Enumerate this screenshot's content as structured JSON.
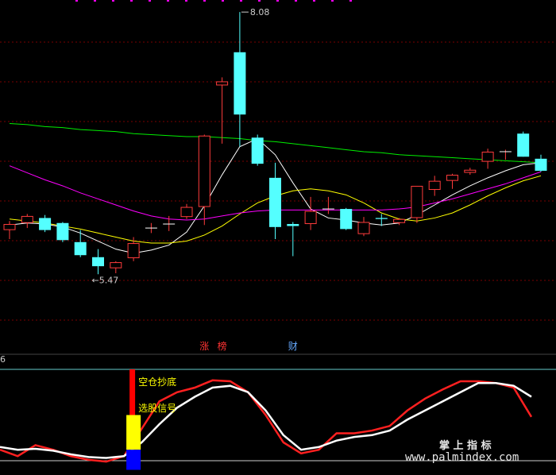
{
  "chart_data": [
    {
      "type": "candlestick",
      "price_range": [
        4.8,
        8.2
      ],
      "grid": "dashed-horizontal",
      "candles": [
        {
          "o": 5.91,
          "h": 6.0,
          "l": 5.82,
          "c": 5.97
        },
        {
          "o": 5.98,
          "h": 6.07,
          "l": 5.93,
          "c": 6.05
        },
        {
          "o": 6.03,
          "h": 6.06,
          "l": 5.89,
          "c": 5.91
        },
        {
          "o": 5.98,
          "h": 5.99,
          "l": 5.79,
          "c": 5.81
        },
        {
          "o": 5.79,
          "h": 5.91,
          "l": 5.64,
          "c": 5.66
        },
        {
          "o": 5.64,
          "h": 5.72,
          "l": 5.47,
          "c": 5.55
        },
        {
          "o": 5.53,
          "h": 5.6,
          "l": 5.48,
          "c": 5.59
        },
        {
          "o": 5.63,
          "h": 5.84,
          "l": 5.6,
          "c": 5.78
        },
        {
          "o": 5.93,
          "h": 5.98,
          "l": 5.88,
          "c": 5.93
        },
        {
          "o": 5.97,
          "h": 6.05,
          "l": 5.9,
          "c": 5.97
        },
        {
          "o": 6.04,
          "h": 6.17,
          "l": 6.02,
          "c": 6.14
        },
        {
          "o": 6.14,
          "h": 6.86,
          "l": 5.96,
          "c": 6.85
        },
        {
          "o": 7.35,
          "h": 7.43,
          "l": 6.77,
          "c": 7.39
        },
        {
          "o": 7.68,
          "h": 8.08,
          "l": 6.74,
          "c": 7.06
        },
        {
          "o": 6.83,
          "h": 6.86,
          "l": 6.55,
          "c": 6.57
        },
        {
          "o": 6.43,
          "h": 6.58,
          "l": 5.82,
          "c": 5.94
        },
        {
          "o": 5.97,
          "h": 5.99,
          "l": 5.65,
          "c": 5.95
        },
        {
          "o": 5.97,
          "h": 6.24,
          "l": 5.91,
          "c": 6.1
        },
        {
          "o": 6.12,
          "h": 6.24,
          "l": 6.07,
          "c": 6.12
        },
        {
          "o": 6.12,
          "h": 6.13,
          "l": 5.91,
          "c": 5.92
        },
        {
          "o": 5.87,
          "h": 6.04,
          "l": 5.85,
          "c": 5.99
        },
        {
          "o": 6.03,
          "h": 6.07,
          "l": 5.95,
          "c": 6.02
        },
        {
          "o": 5.98,
          "h": 6.03,
          "l": 5.96,
          "c": 6.02
        },
        {
          "o": 6.03,
          "h": 6.35,
          "l": 5.98,
          "c": 6.35
        },
        {
          "o": 6.31,
          "h": 6.45,
          "l": 6.25,
          "c": 6.4
        },
        {
          "o": 6.4,
          "h": 6.47,
          "l": 6.32,
          "c": 6.46
        },
        {
          "o": 6.48,
          "h": 6.53,
          "l": 6.46,
          "c": 6.51
        },
        {
          "o": 6.59,
          "h": 6.72,
          "l": 6.52,
          "c": 6.69
        },
        {
          "o": 6.69,
          "h": 6.71,
          "l": 6.61,
          "c": 6.69
        },
        {
          "o": 6.87,
          "h": 6.89,
          "l": 6.64,
          "c": 6.64
        },
        {
          "o": 6.62,
          "h": 6.66,
          "l": 6.49,
          "c": 6.5
        }
      ],
      "ma_lines": [
        {
          "color": "#ffffff",
          "values": [
            5.96,
            5.98,
            5.97,
            5.94,
            5.88,
            5.8,
            5.72,
            5.68,
            5.71,
            5.76,
            5.89,
            6.15,
            6.46,
            6.74,
            6.82,
            6.66,
            6.38,
            6.12,
            6.03,
            6.01,
            5.98,
            5.96,
            5.98,
            6.06,
            6.16,
            6.26,
            6.35,
            6.43,
            6.5,
            6.56,
            6.58
          ]
        },
        {
          "color": "#ffff00",
          "values": [
            6.02,
            6.0,
            5.98,
            5.95,
            5.92,
            5.88,
            5.84,
            5.8,
            5.78,
            5.78,
            5.8,
            5.86,
            5.95,
            6.07,
            6.18,
            6.25,
            6.3,
            6.32,
            6.3,
            6.26,
            6.18,
            6.08,
            6.02,
            6.0,
            6.03,
            6.08,
            6.16,
            6.25,
            6.33,
            6.4,
            6.45
          ]
        },
        {
          "color": "#ff00ff",
          "values": [
            6.55,
            6.48,
            6.41,
            6.35,
            6.28,
            6.22,
            6.16,
            6.1,
            6.05,
            6.02,
            6.01,
            6.02,
            6.05,
            6.08,
            6.1,
            6.11,
            6.11,
            6.11,
            6.11,
            6.11,
            6.11,
            6.11,
            6.12,
            6.14,
            6.18,
            6.22,
            6.27,
            6.32,
            6.37,
            6.43,
            6.49
          ]
        },
        {
          "color": "#00ee00",
          "values": [
            6.97,
            6.96,
            6.94,
            6.93,
            6.91,
            6.9,
            6.89,
            6.87,
            6.86,
            6.85,
            6.84,
            6.84,
            6.83,
            6.82,
            6.8,
            6.79,
            6.77,
            6.75,
            6.73,
            6.71,
            6.69,
            6.68,
            6.66,
            6.65,
            6.64,
            6.63,
            6.62,
            6.61,
            6.6,
            6.59,
            6.58
          ]
        }
      ],
      "annotations": [
        {
          "text": "8.08",
          "candle": 13,
          "price": 8.08
        },
        {
          "text": "←5.47",
          "candle": 5,
          "price": 5.47
        }
      ],
      "markers": [
        {
          "text": "涨",
          "candle": 11,
          "color": "#ff3333"
        },
        {
          "text": "榜",
          "candle": 12,
          "color": "#ff3333"
        },
        {
          "text": "财",
          "candle": 16,
          "color": "#66aaff"
        }
      ]
    },
    {
      "type": "line",
      "label": "6",
      "y_range": [
        0,
        100
      ],
      "ref_lines": [
        {
          "value": 100,
          "color": "#66cccc"
        },
        {
          "value": 0,
          "color": "#cccccc"
        }
      ],
      "series": [
        {
          "color": "#ff2020",
          "values": [
            12,
            5,
            17,
            12,
            5,
            1,
            -1,
            5,
            35,
            65,
            75,
            80,
            88,
            87,
            75,
            50,
            20,
            8,
            12,
            30,
            30,
            33,
            38,
            55,
            68,
            78,
            87,
            87,
            85,
            80,
            48
          ]
        },
        {
          "color": "#ffffff",
          "values": [
            15,
            12,
            13,
            11,
            7,
            4,
            3,
            5,
            20,
            40,
            58,
            70,
            80,
            82,
            75,
            55,
            28,
            12,
            15,
            22,
            26,
            28,
            33,
            45,
            55,
            65,
            75,
            85,
            85,
            82,
            70
          ]
        }
      ],
      "signal_bar": {
        "candle": 7,
        "segments": [
          {
            "color": "#ff0000",
            "from": 50,
            "to": 100
          },
          {
            "color": "#ffff00",
            "from": 12,
            "to": 50
          },
          {
            "color": "#0000ff",
            "from": -10,
            "to": 12
          }
        ]
      },
      "labels": [
        {
          "text": "空仓抄底",
          "color": "#ffff00"
        },
        {
          "text": "选股信号",
          "color": "#ffff00"
        }
      ]
    }
  ],
  "watermark": {
    "line1": "掌 上 指 标",
    "line2": "www.palmindex.com"
  },
  "colors": {
    "up": "#ff3b3b",
    "down": "#54ffff",
    "grid": "#7a0000",
    "background": "#000000"
  }
}
